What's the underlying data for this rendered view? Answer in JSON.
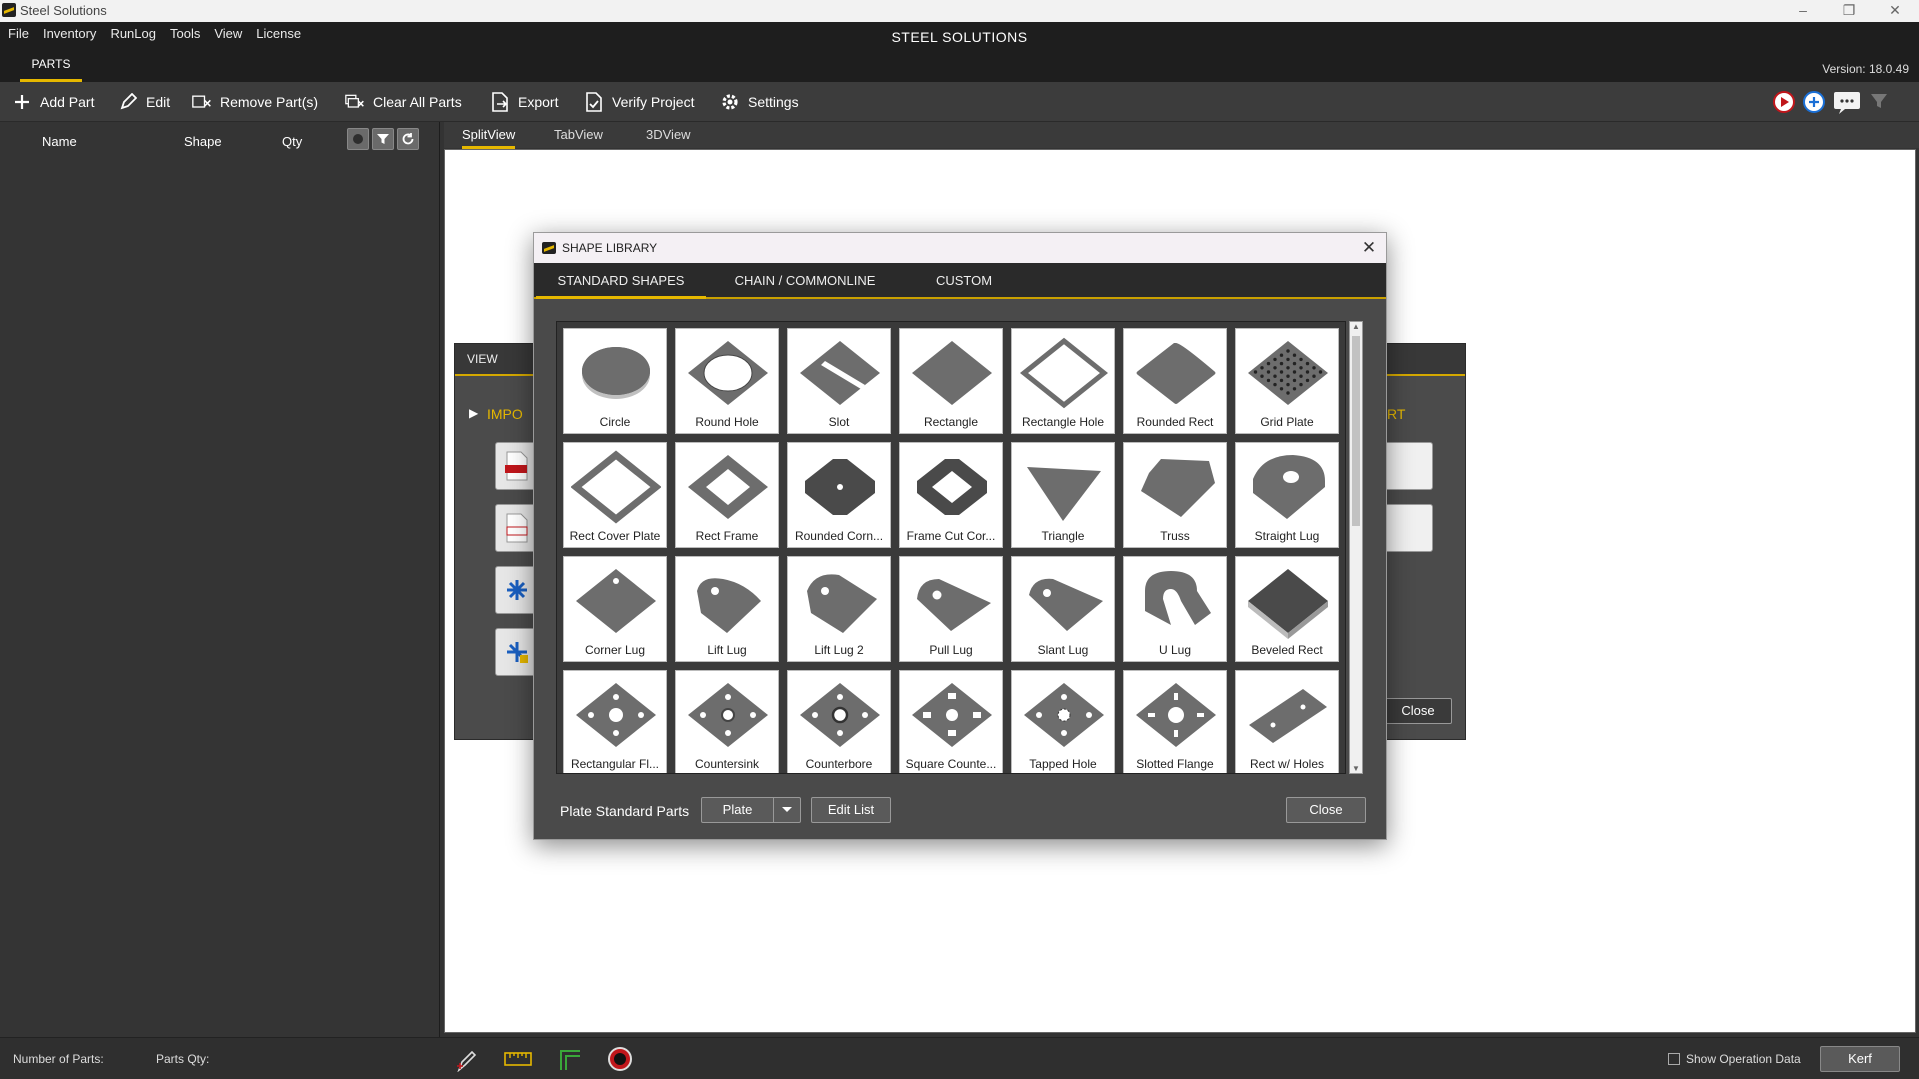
{
  "window": {
    "title": "Steel Solutions",
    "controls": [
      "minimize-icon",
      "restore-icon",
      "close-icon"
    ]
  },
  "menu": [
    "File",
    "Inventory",
    "RunLog",
    "Tools",
    "View",
    "License"
  ],
  "app_title": "STEEL SOLUTIONS",
  "ribbon_tab": "PARTS",
  "version": "Version: 18.0.49",
  "toolbar": {
    "add_part": "Add Part",
    "edit": "Edit",
    "remove_parts": "Remove Part(s)",
    "clear_all": "Clear All Parts",
    "export": "Export",
    "verify": "Verify Project",
    "settings": "Settings"
  },
  "parts_list": {
    "headers": [
      "Name",
      "Shape",
      "Qty"
    ]
  },
  "view_tabs": [
    "SplitView",
    "TabView",
    "3DView"
  ],
  "active_view_tab": "SplitView",
  "bg_dialog": {
    "title": "VIEW",
    "import_label": "IMPO",
    "right_label": "RT",
    "close": "Close"
  },
  "shape_library": {
    "title": "SHAPE LIBRARY",
    "tabs": [
      "STANDARD SHAPES",
      "CHAIN / COMMONLINE",
      "CUSTOM"
    ],
    "active_tab": "STANDARD SHAPES",
    "shapes": [
      "Circle",
      "Round Hole",
      "Slot",
      "Rectangle",
      "Rectangle Hole",
      "Rounded Rect",
      "Grid Plate",
      "Rect Cover Plate",
      "Rect Frame",
      "Rounded Corn...",
      "Frame Cut Cor...",
      "Triangle",
      "Truss",
      "Straight Lug",
      "Corner Lug",
      "Lift Lug",
      "Lift Lug 2",
      "Pull Lug",
      "Slant Lug",
      "U Lug",
      "Beveled Rect",
      "Rectangular Fl...",
      "Countersink",
      "Counterbore",
      "Square Counte...",
      "Tapped Hole",
      "Slotted Flange",
      "Rect w/ Holes"
    ],
    "footer_label": "Plate Standard Parts",
    "dropdown_value": "Plate",
    "edit_list": "Edit List",
    "close": "Close"
  },
  "status": {
    "num_parts_label": "Number of Parts:",
    "parts_qty_label": "Parts Qty:",
    "show_op_label": "Show Operation Data",
    "show_op_checked": false,
    "kerf": "Kerf"
  },
  "colors": {
    "accent": "#e6b800",
    "plate": "#6d6d6d"
  }
}
